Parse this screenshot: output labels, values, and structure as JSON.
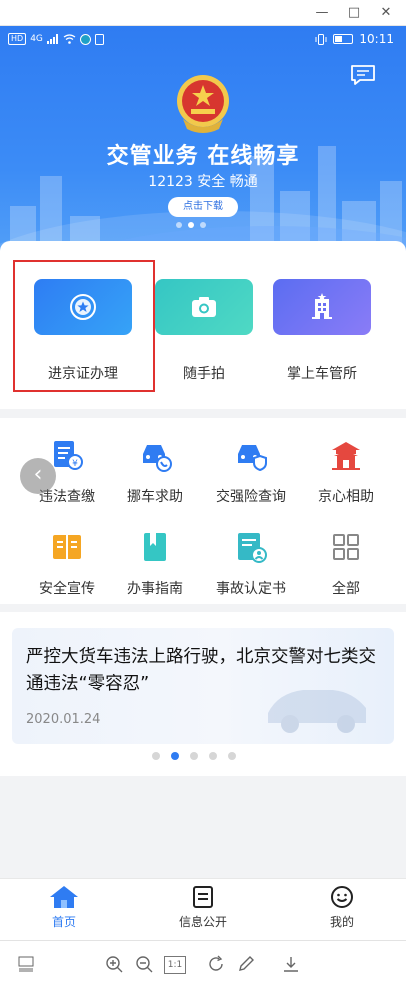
{
  "window": {
    "minimize": "—",
    "maximize": "□",
    "close": "✕"
  },
  "statusbar": {
    "left_chip": "HD",
    "network": "4G",
    "time": "10:11"
  },
  "hero": {
    "title": "交管业务 在线畅享",
    "subtitle": "12123 安全 畅通",
    "download_label": "点击下载"
  },
  "features": [
    {
      "label": "进京证办理",
      "icon": "star-badge-icon"
    },
    {
      "label": "随手拍",
      "icon": "camera-icon"
    },
    {
      "label": "掌上车管所",
      "icon": "building-icon"
    }
  ],
  "services": [
    {
      "label": "违法查缴",
      "icon": "fine-doc-icon"
    },
    {
      "label": "挪车求助",
      "icon": "car-call-icon"
    },
    {
      "label": "交强险查询",
      "icon": "car-shield-icon"
    },
    {
      "label": "京心相助",
      "icon": "temple-icon"
    },
    {
      "label": "安全宣传",
      "icon": "book-icon"
    },
    {
      "label": "办事指南",
      "icon": "bookmark-icon"
    },
    {
      "label": "事故认定书",
      "icon": "certificate-icon"
    },
    {
      "label": "全部",
      "icon": "grid-icon"
    }
  ],
  "news": {
    "title": "严控大货车违法上路行驶，北京交警对七类交通违法“零容忍”",
    "date": "2020.01.24",
    "carousel_active_index": 1,
    "carousel_count": 5
  },
  "tabs": [
    {
      "label": "首页",
      "icon": "home-icon",
      "active": true
    },
    {
      "label": "信息公开",
      "icon": "document-icon",
      "active": false
    },
    {
      "label": "我的",
      "icon": "smile-icon",
      "active": false
    }
  ],
  "colors": {
    "primary": "#2f7cf2",
    "highlight": "#e0312f",
    "teal": "#35c6c4",
    "purple": "#6a70f3",
    "orange": "#f5a623",
    "red": "#e5483f"
  },
  "viewer_toolbar": {
    "zoom_reset": "1:1"
  }
}
